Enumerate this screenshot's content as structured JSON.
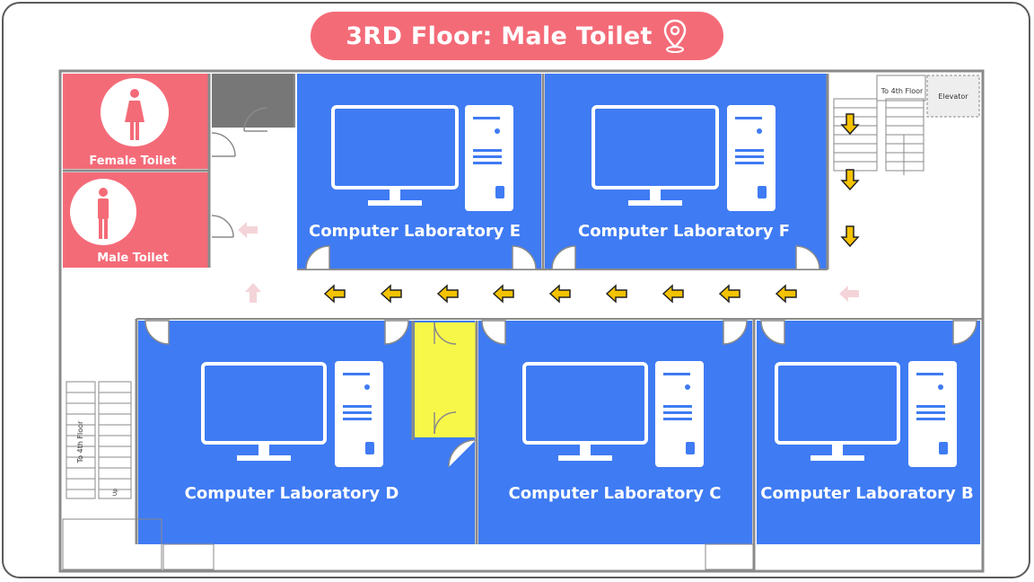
{
  "title": "3RD Floor: Male Toilet",
  "icons": {
    "title": "location-pin-icon",
    "computer": "computer-monitor-icon",
    "tower": "pc-tower-icon",
    "female": "female-person-icon",
    "male": "male-person-icon",
    "arrow": "arrow-icon"
  },
  "colors": {
    "lab": "#3f7bf3",
    "toilet": "#f46b78",
    "highlight": "#f7f74a",
    "route_arrow": "#f5c200",
    "faded_arrow": "#f4d4d8",
    "wall": "#8a8a8a",
    "dark_block": "#777777"
  },
  "rooms": {
    "female_toilet": "Female Toilet",
    "male_toilet": "Male Toilet",
    "lab_e": "Computer Laboratory E",
    "lab_f": "Computer Laboratory F",
    "lab_d": "Computer Laboratory D",
    "lab_c": "Computer Laboratory C",
    "lab_b": "Computer Laboratory B"
  },
  "labels": {
    "to_4th_floor_top": "To 4th Floor",
    "to_4th_floor_left": "To 4th Floor",
    "elevator": "Elevator",
    "up": "Up"
  }
}
